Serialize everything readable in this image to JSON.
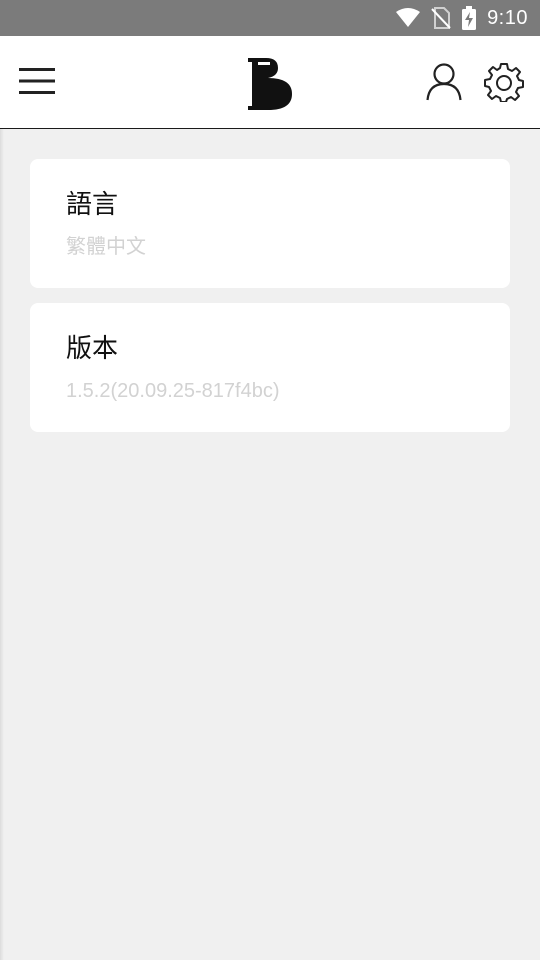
{
  "status_bar": {
    "time": "9:10",
    "icons": [
      "wifi-icon",
      "no-sim-icon",
      "battery-charging-icon"
    ]
  },
  "app_bar": {
    "menu_icon": "hamburger-menu-icon",
    "logo_text": "B",
    "profile_icon": "user-icon",
    "settings_icon": "gear-icon"
  },
  "settings": [
    {
      "label": "語言",
      "value": "繁體中文"
    },
    {
      "label": "版本",
      "value": "1.5.2(20.09.25-817f4bc)"
    }
  ],
  "colors": {
    "status_bar": "#7b7b7b",
    "background": "#f0f0f0",
    "card": "#ffffff",
    "secondary_text": "#d2d2d2"
  }
}
